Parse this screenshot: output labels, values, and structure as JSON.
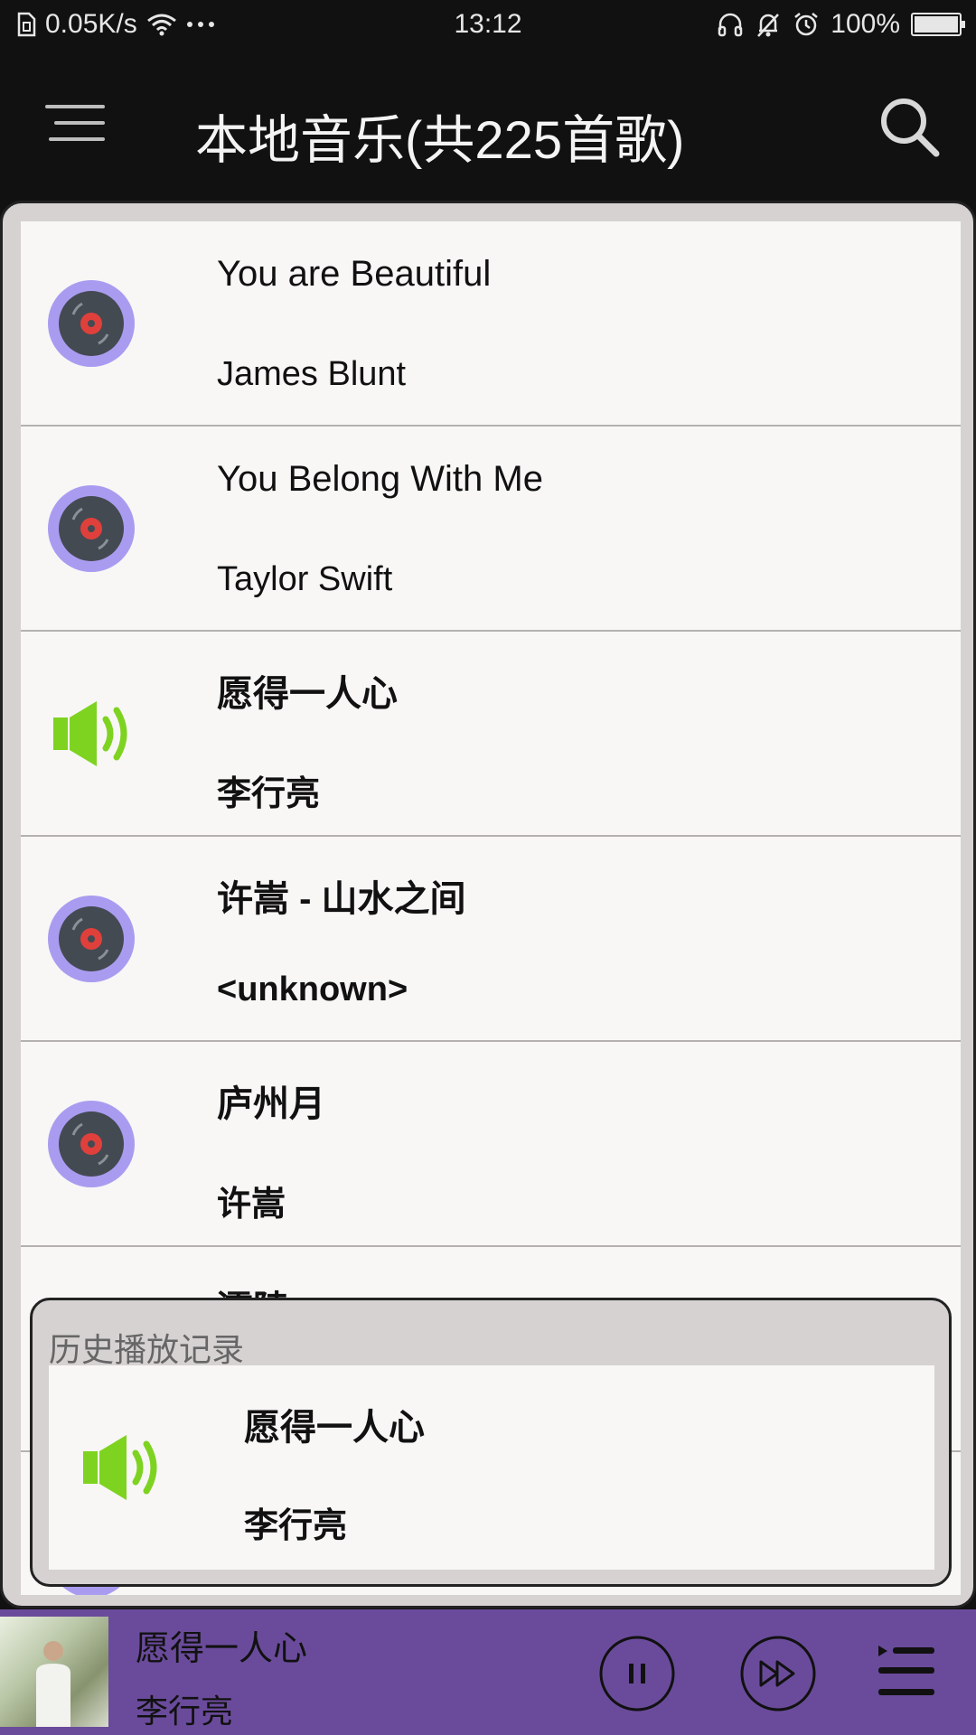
{
  "status_bar": {
    "speed": "0.05K/s",
    "time": "13:12",
    "battery": "100%"
  },
  "header": {
    "title": "本地音乐(共225首歌)"
  },
  "songs": [
    {
      "title": "You are Beautiful",
      "artist": "James Blunt",
      "icon": "vinyl-disc-icon"
    },
    {
      "title": "You Belong With Me",
      "artist": "Taylor Swift",
      "icon": "vinyl-disc-icon"
    },
    {
      "title": "愿得一人心",
      "artist": "李行亮",
      "icon": "speaker-playing-icon"
    },
    {
      "title": "许嵩 - 山水之间",
      "artist": "<unknown>",
      "icon": "vinyl-disc-icon"
    },
    {
      "title": "庐州月",
      "artist": "许嵩",
      "icon": "vinyl-disc-icon"
    },
    {
      "title": "灞陵",
      "artist": "",
      "icon": "vinyl-disc-icon"
    }
  ],
  "history": {
    "title": "历史播放记录",
    "item": {
      "title": "愿得一人心",
      "artist": "李行亮",
      "icon": "speaker-playing-icon"
    }
  },
  "player": {
    "title": "愿得一人心",
    "artist": "李行亮"
  },
  "colors": {
    "header_bg": "#111111",
    "list_bg": "#f8f7f6",
    "frame_bg": "#d7d2d2",
    "player_bg": "#6a4b9b",
    "vinyl_ring": "#a99cf0",
    "speaker_green": "#7ed321"
  }
}
